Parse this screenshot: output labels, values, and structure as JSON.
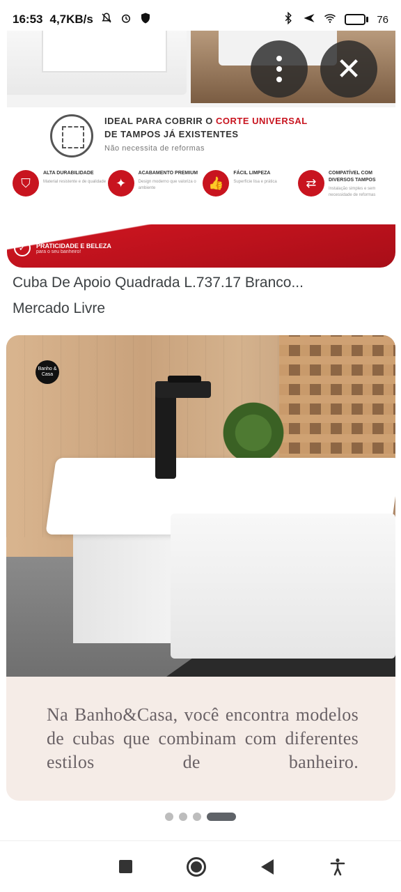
{
  "status_bar": {
    "time": "16:53",
    "speed": "4,7KB/s",
    "battery_text": "76",
    "battery_level": 0.76,
    "icons": [
      "mute-icon",
      "alarm-icon",
      "shield-icon",
      "bluetooth-icon",
      "airplane-icon",
      "wifi-icon",
      "battery-icon"
    ]
  },
  "card1": {
    "headline_line1_a": "IDEAL PARA COBRIR O ",
    "headline_line1_b": "CORTE UNIVERSAL",
    "headline_line2": "DE TAMPOS JÁ EXISTENTES",
    "headline_sub": "Não necessita de reformas",
    "features": [
      {
        "title": "ALTA DURABILIDADE",
        "desc": "Material resistente e de qualidade",
        "icon": "shield-icon"
      },
      {
        "title": "ACABAMENTO PREMIUM",
        "desc": "Design moderno que valoriza o ambiente",
        "icon": "sparkle-icon"
      },
      {
        "title": "FÁCIL LIMPEZA",
        "desc": "Superfície lisa e prática",
        "icon": "thumbs-up-icon"
      },
      {
        "title": "COMPATÍVEL COM DIVERSOS TAMPOS",
        "desc": "Instalação simples e sem necessidade de reformas",
        "icon": "compare-icon"
      }
    ],
    "banner_title": "PRATICIDADE E BELEZA",
    "banner_sub": "para o seu banheiro!"
  },
  "actions": {
    "more_icon": "more-vert-icon",
    "close_icon": "close-icon",
    "close_glyph": "✕"
  },
  "result": {
    "title": "Cuba De Apoio Quadrada L.737.17 Branco...",
    "source": "Mercado Livre"
  },
  "main_image": {
    "logo_text": "Banho & Casa",
    "caption": "Na Banho&Casa, você encontra modelos de cubas que combinam com diferentes estilos de banheiro."
  },
  "pager": {
    "count": 4,
    "active_index": 3
  },
  "nav": {
    "buttons": [
      "recents-button",
      "home-button",
      "back-button",
      "accessibility-button"
    ]
  }
}
